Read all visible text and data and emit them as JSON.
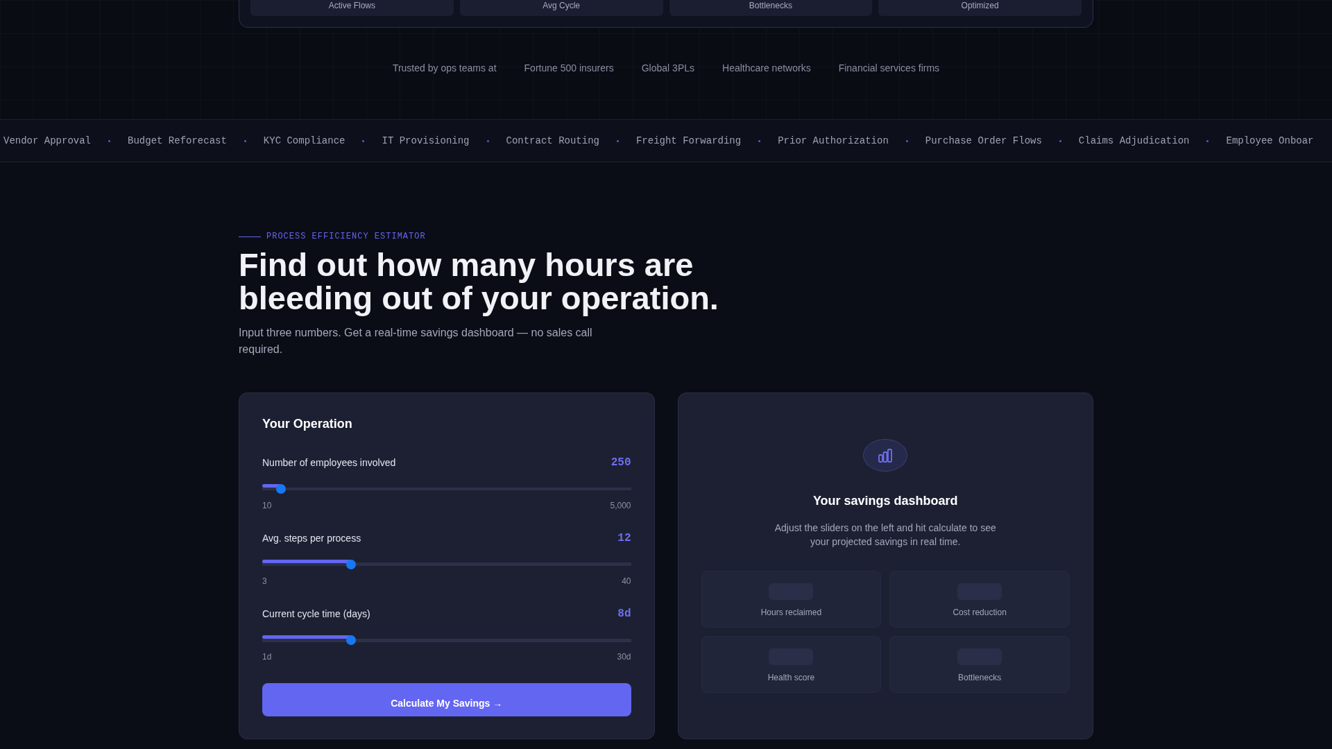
{
  "top_panel": {
    "stats": [
      {
        "label": "Active Flows"
      },
      {
        "label": "Avg Cycle"
      },
      {
        "label": "Bottlenecks"
      },
      {
        "label": "Optimized"
      }
    ]
  },
  "trusted": {
    "intro": "Trusted by ops teams at",
    "names": [
      "Fortune 500 insurers",
      "Global 3PLs",
      "Healthcare networks",
      "Financial services firms"
    ]
  },
  "ticker": [
    "Vendor Approval",
    "Budget Reforecast",
    "KYC Compliance",
    "IT Provisioning",
    "Contract Routing",
    "Freight Forwarding",
    "Prior Authorization",
    "Purchase Order Flows",
    "Claims Adjudication",
    "Employee Onboar"
  ],
  "hero": {
    "eyebrow": "PROCESS EFFICIENCY ESTIMATOR",
    "title": "Find out how many hours are bleeding out of your operation.",
    "subtitle": "Input three numbers. Get a real-time savings dashboard — no sales call required."
  },
  "operation": {
    "title": "Your Operation",
    "sliders": [
      {
        "label": "Number of employees involved",
        "value": "250",
        "level": 0.05,
        "min": "10",
        "max": "5,000"
      },
      {
        "label": "Avg. steps per process",
        "value": "12",
        "level": 0.24,
        "min": "3",
        "max": "40"
      },
      {
        "label": "Current cycle time (days)",
        "value": "8d",
        "level": 0.24,
        "min": "1d",
        "max": "30d"
      }
    ],
    "button": "Calculate My Savings →"
  },
  "dashboard": {
    "title": "Your savings dashboard",
    "description": "Adjust the sliders on the left and hit calculate to see your projected savings in real time.",
    "metrics": [
      {
        "label": "Hours reclaimed"
      },
      {
        "label": "Cost reduction"
      },
      {
        "label": "Health score"
      },
      {
        "label": "Bottlenecks"
      }
    ]
  }
}
